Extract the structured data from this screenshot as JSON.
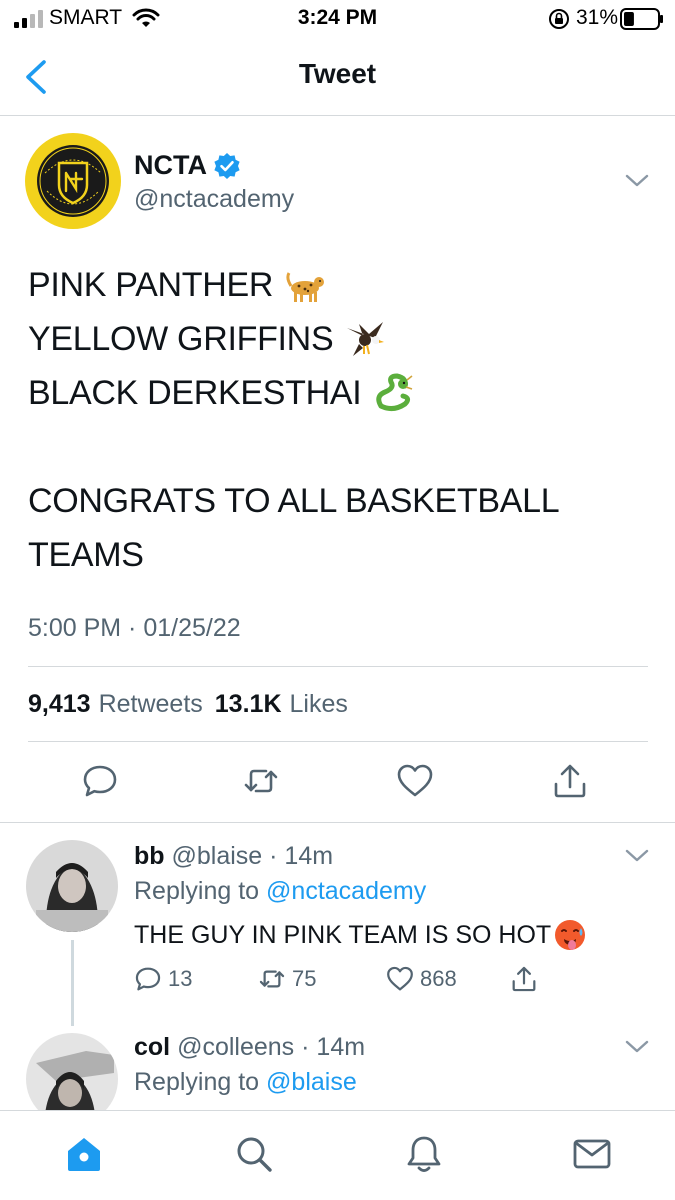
{
  "status_bar": {
    "carrier": "SMART",
    "time": "3:24 PM",
    "battery_percent": "31%",
    "battery_level": 0.31
  },
  "nav": {
    "title": "Tweet",
    "back_icon": "chevron-left-icon"
  },
  "tweet": {
    "author": {
      "name": "NCTA",
      "handle": "@nctacademy",
      "verified": true
    },
    "lines": [
      {
        "text": "PINK PANTHER",
        "emoji": "leopard-emoji"
      },
      {
        "text": "YELLOW GRIFFINS",
        "emoji": "eagle-emoji"
      },
      {
        "text": "BLACK DERKESTHAI",
        "emoji": "dragon-emoji"
      },
      {
        "text": "CONGRATS TO ALL BASKETBALL"
      },
      {
        "text": "TEAMS"
      }
    ],
    "timestamp": "5:00 PM · 01/25/22",
    "retweets_count": "9,413",
    "retweets_label": "Retweets",
    "likes_count": "13.1K",
    "likes_label": "Likes",
    "actions": [
      "reply-icon",
      "retweet-icon",
      "like-icon",
      "share-icon"
    ]
  },
  "replies": [
    {
      "name": "bb",
      "handle": "@blaise",
      "age": "· 14m",
      "replying_prefix": "Replying to",
      "replying_to": "@nctacademy",
      "text": "THE GUY IN PINK TEAM IS SO HOT",
      "text_emoji": "hot-face-emoji",
      "reply_count": "13",
      "retweet_count": "75",
      "like_count": "868"
    },
    {
      "name": "col",
      "handle": "@colleens",
      "age": "· 14m",
      "replying_prefix": "Replying to",
      "replying_to": "@blaise"
    }
  ],
  "tabbar": {
    "tabs": [
      "home-icon",
      "search-icon",
      "notifications-icon",
      "messages-icon"
    ],
    "active": "home-icon"
  },
  "colors": {
    "accent": "#1d9bf0",
    "text": "#0f1419",
    "muted": "#536471",
    "divider": "#d5d9dc",
    "ncta_gold": "#f2d21c"
  }
}
